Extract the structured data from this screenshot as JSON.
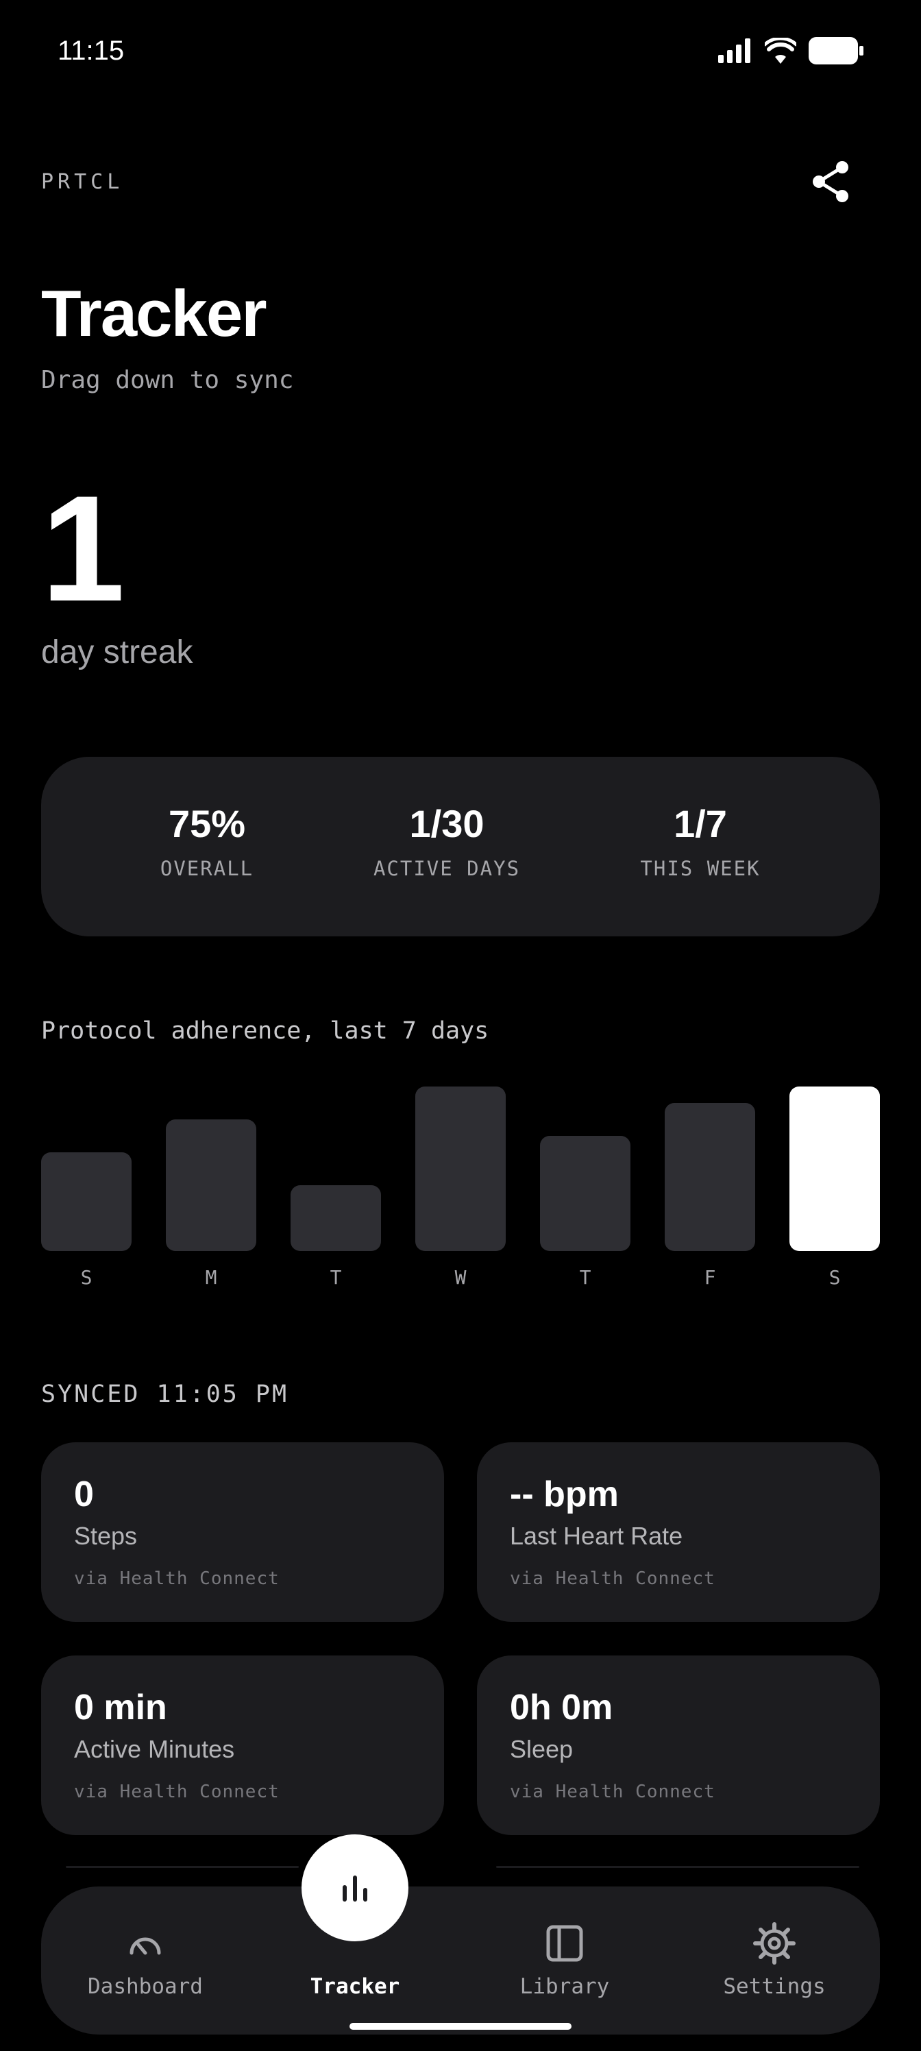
{
  "status_bar": {
    "time": "11:15",
    "icons": [
      "signal-icon",
      "wifi-icon",
      "battery-icon"
    ]
  },
  "header": {
    "brand": "PRTCL",
    "share_icon": "share-icon"
  },
  "page": {
    "title": "Tracker",
    "subtitle": "Drag down to sync"
  },
  "streak": {
    "value": "1",
    "label": "day streak"
  },
  "stats": [
    {
      "value": "75%",
      "label": "OVERALL"
    },
    {
      "value": "1/30",
      "label": "ACTIVE DAYS"
    },
    {
      "value": "1/7",
      "label": "THIS WEEK"
    }
  ],
  "chart_data": {
    "type": "bar",
    "title": "Protocol adherence, last 7 days",
    "categories": [
      "S",
      "M",
      "T",
      "W",
      "T",
      "F",
      "S"
    ],
    "values": [
      60,
      80,
      40,
      100,
      70,
      90,
      100
    ],
    "highlighted_index": 6,
    "bar_color": "#2e2e33",
    "highlight_color": "#ffffff"
  },
  "sync": {
    "label": "SYNCED 11:05 PM"
  },
  "metrics": [
    {
      "value": "0",
      "label": "Steps",
      "source": "via Health Connect"
    },
    {
      "value": "-- bpm",
      "label": "Last Heart Rate",
      "source": "via Health Connect"
    },
    {
      "value": "0 min",
      "label": "Active Minutes",
      "source": "via Health Connect"
    },
    {
      "value": "0h 0m",
      "label": "Sleep",
      "source": "via Health Connect"
    }
  ],
  "nav": {
    "items": [
      {
        "label": "Dashboard",
        "icon": "gauge-icon"
      },
      {
        "label": "Tracker",
        "icon": "bar-chart-icon",
        "active": true
      },
      {
        "label": "Library",
        "icon": "book-icon"
      },
      {
        "label": "Settings",
        "icon": "gear-icon"
      }
    ]
  },
  "colors": {
    "background": "#000000",
    "card": "#1c1c1f",
    "bar": "#2e2e33",
    "muted_text": "#a6a6aa"
  }
}
